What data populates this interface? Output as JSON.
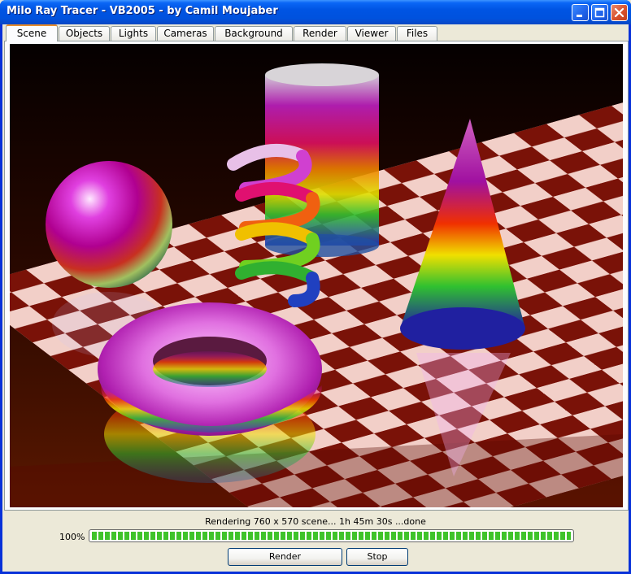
{
  "window": {
    "title": "Milo Ray Tracer - VB2005 - by Camil Moujaber"
  },
  "titlebar_buttons": [
    {
      "name": "minimize",
      "icon": "minimize-icon"
    },
    {
      "name": "maximize",
      "icon": "maximize-icon"
    },
    {
      "name": "close",
      "icon": "close-icon"
    }
  ],
  "tabs": [
    {
      "label": "Scene",
      "active": true
    },
    {
      "label": "Objects"
    },
    {
      "label": "Lights"
    },
    {
      "label": "Cameras"
    },
    {
      "label": "Background"
    },
    {
      "label": "Render"
    },
    {
      "label": "Viewer"
    },
    {
      "label": "Files"
    }
  ],
  "render": {
    "objects": [
      "sphere",
      "torus",
      "helix",
      "cylinder",
      "cone"
    ],
    "floor": "checkerboard",
    "colors": {
      "checker_dark": "#7A1208",
      "checker_light": "#F2CFC8"
    }
  },
  "status": {
    "message": "Rendering 760 x 570 scene... 1h 45m 30s ...done",
    "percent_label": "100%",
    "progress": 1.0
  },
  "buttons": {
    "render_label": "Render",
    "stop_label": "Stop"
  },
  "colors": {
    "titlebar": "#0054E3",
    "progress": "#3FC32A",
    "tab_highlight": "#E68B2C"
  }
}
